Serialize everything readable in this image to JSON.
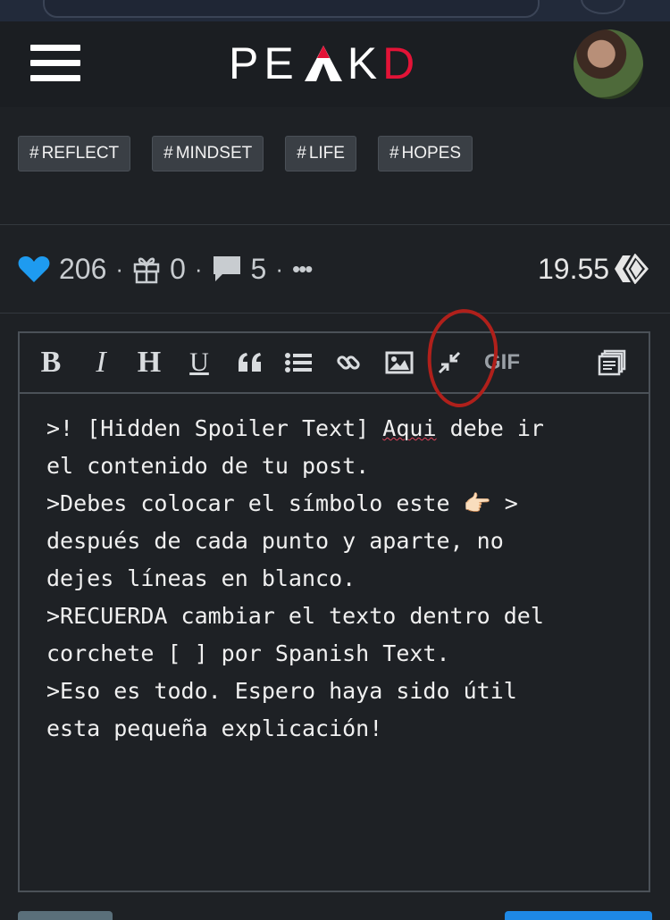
{
  "app": {
    "logo_left": "PE",
    "logo_mid": "A",
    "logo_k": "K",
    "logo_right": "D",
    "brand_color": "#e31337"
  },
  "tags": [
    "REFLECT",
    "MINDSET",
    "LIFE",
    "HOPES"
  ],
  "stats": {
    "likes": "206",
    "gifts": "0",
    "comments": "5",
    "more": "•••",
    "payout": "19.55"
  },
  "toolbar": {
    "bold": "B",
    "italic": "I",
    "heading": "H",
    "underline": "U",
    "gif": "GIF"
  },
  "editor": {
    "line1a": ">! [Hidden Spoiler Text] ",
    "line1b": "Aqui",
    "line1c": " debe ir",
    "line2": "el contenido de tu post.",
    "line3a": ">Debes colocar el símbolo este ",
    "line3b": " >",
    "line4": "después de cada punto y aparte, no",
    "line5": "dejes líneas en blanco.",
    "line6": ">RECUERDA cambiar el texto dentro del",
    "line7": "corchete [ ] por Spanish Text.",
    "line8": ">Eso es todo. Espero haya sido útil",
    "line9": "esta pequeña explicación!",
    "emoji": "👉🏻"
  },
  "icons": [
    "menu-icon",
    "heart-icon",
    "gift-icon",
    "comment-icon",
    "hive-icon",
    "quote-icon",
    "list-icon",
    "link-icon",
    "image-icon",
    "collapse-icon",
    "snippets-icon"
  ]
}
